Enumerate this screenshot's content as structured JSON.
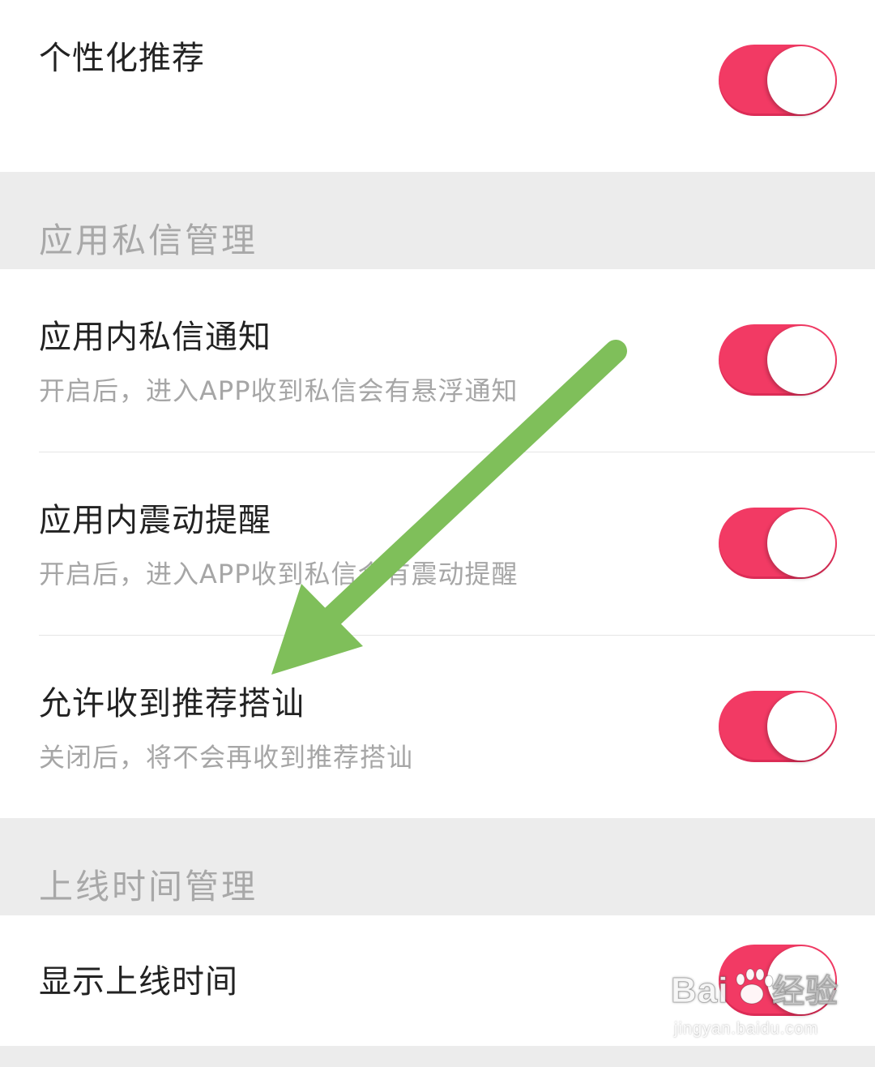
{
  "sections": [
    {
      "header": "",
      "rows": [
        {
          "title": "个性化推荐",
          "desc": "",
          "toggle_on": true
        }
      ]
    },
    {
      "header": "应用私信管理",
      "rows": [
        {
          "title": "应用内私信通知",
          "desc": "开启后，进入APP收到私信会有悬浮通知",
          "toggle_on": true
        },
        {
          "title": "应用内震动提醒",
          "desc": "开启后，进入APP收到私信会有震动提醒",
          "toggle_on": true
        },
        {
          "title": "允许收到推荐搭讪",
          "desc": "关闭后，将不会再收到推荐搭讪",
          "toggle_on": true
        }
      ]
    },
    {
      "header": "上线时间管理",
      "rows": [
        {
          "title": "显示上线时间",
          "desc": "",
          "toggle_on": true
        }
      ]
    }
  ],
  "colors": {
    "toggle_on": "#f23a64",
    "annotation_arrow": "#7fbf5a",
    "section_bg": "#ececec"
  },
  "watermark": {
    "logo": "Bai du 经验",
    "url": "jingyan.baidu.com"
  }
}
